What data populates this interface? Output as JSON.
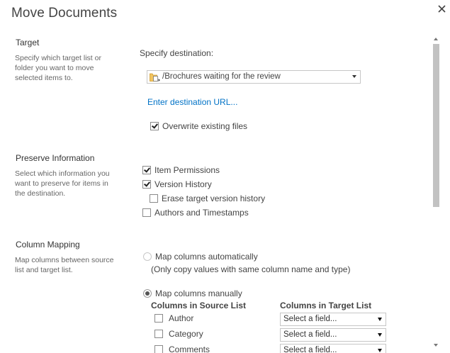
{
  "dialog": {
    "title": "Move Documents"
  },
  "target": {
    "heading": "Target",
    "description": "Specify which target list or folder you want to move selected items to.",
    "destination_label": "Specify destination:",
    "destination_value": "/Brochures waiting for the review",
    "destination_icon": "folder-icon",
    "enter_url_link": "Enter destination URL...",
    "overwrite_label": "Overwrite existing files",
    "overwrite_checked": true
  },
  "preserve": {
    "heading": "Preserve Information",
    "description": "Select which information you want to preserve for items in the destination.",
    "options": [
      {
        "label": "Item Permissions",
        "checked": true
      },
      {
        "label": "Version History",
        "checked": true
      },
      {
        "label": "Erase target version history",
        "checked": false
      },
      {
        "label": "Authors and Timestamps",
        "checked": false
      }
    ]
  },
  "column_mapping": {
    "heading": "Column Mapping",
    "description": "Map columns between source list and target list.",
    "auto_label": "Map columns automatically",
    "auto_note": "(Only copy values with same column name and type)",
    "manual_label": "Map columns manually",
    "selected": "manual",
    "source_header": "Columns in Source List",
    "target_header": "Columns in Target List",
    "rows": [
      {
        "source": "Author",
        "target": "Select a field..."
      },
      {
        "source": "Category",
        "target": "Select a field..."
      },
      {
        "source": "Comments",
        "target": "Select a field..."
      }
    ]
  },
  "colors": {
    "link": "#0072c6",
    "text": "#444444",
    "scroll_thumb": "#c2c2c2"
  }
}
